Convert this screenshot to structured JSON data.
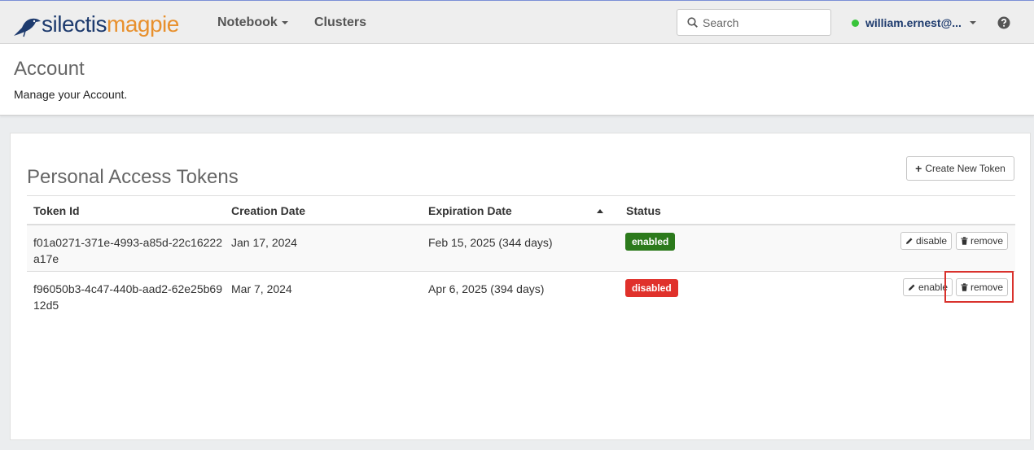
{
  "brand": {
    "part1": "silectis",
    "part2": "magpie"
  },
  "nav": {
    "notebook": "Notebook",
    "clusters": "Clusters"
  },
  "search": {
    "placeholder": "Search"
  },
  "user": {
    "name": "william.ernest@..."
  },
  "header": {
    "title": "Account",
    "subtitle": "Manage your Account."
  },
  "tokens": {
    "title": "Personal Access Tokens",
    "create_label": "Create New Token",
    "columns": [
      "Token Id",
      "Creation Date",
      "Expiration Date",
      "Status"
    ],
    "rows": [
      {
        "id": "f01a0271-371e-4993-a85d-22c16222a17e",
        "created": "Jan 17, 2024",
        "expires": "Feb 15, 2025 (344 days)",
        "status": "enabled",
        "toggle": "disable",
        "remove": "remove"
      },
      {
        "id": "f96050b3-4c47-440b-aad2-62e25b6912d5",
        "created": "Mar 7, 2024",
        "expires": "Apr 6, 2025 (394 days)",
        "status": "disabled",
        "toggle": "enable",
        "remove": "remove"
      }
    ]
  },
  "colors": {
    "brand_dark": "#1e3b6e",
    "brand_orange": "#e8902d",
    "enabled": "#2c7a1c",
    "disabled": "#e0312b",
    "highlight": "#d9322d"
  }
}
